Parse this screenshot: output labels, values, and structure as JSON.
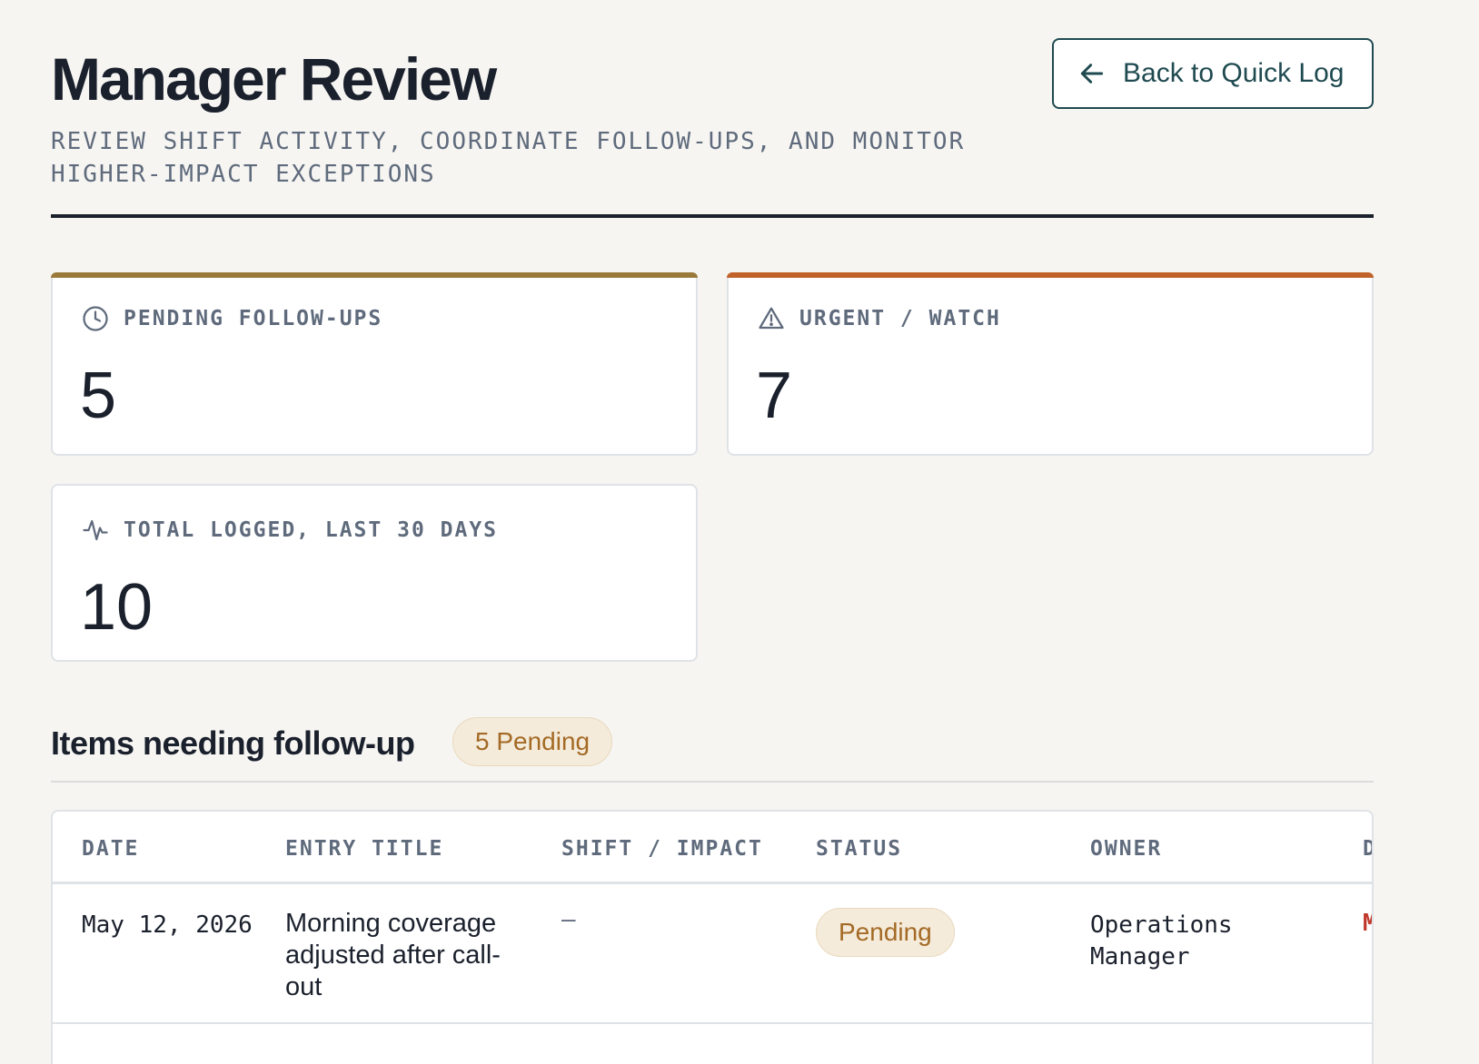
{
  "header": {
    "title": "Manager Review",
    "subtitle": "REVIEW SHIFT ACTIVITY, COORDINATE FOLLOW-UPS, AND MONITOR HIGHER-IMPACT EXCEPTIONS",
    "back_label": "Back to Quick Log"
  },
  "stats": {
    "pending": {
      "label": "PENDING FOLLOW-UPS",
      "value": "5",
      "accent": "#9a7a3a"
    },
    "urgent": {
      "label": "URGENT / WATCH",
      "value": "7",
      "accent": "#c0622a"
    },
    "total": {
      "label": "TOTAL LOGGED, LAST 30 DAYS",
      "value": "10"
    }
  },
  "followups": {
    "title": "Items needing follow-up",
    "badge": "5 Pending",
    "columns": {
      "date": "DATE",
      "title": "ENTRY TITLE",
      "impact": "SHIFT / IMPACT",
      "status": "STATUS",
      "owner": "OWNER",
      "due": "D"
    },
    "rows": [
      {
        "date": "May 12, 2026",
        "title": "Morning coverage adjusted after call-out",
        "impact": "–",
        "status": "Pending",
        "owner": "Operations Manager",
        "due": "M"
      }
    ]
  }
}
